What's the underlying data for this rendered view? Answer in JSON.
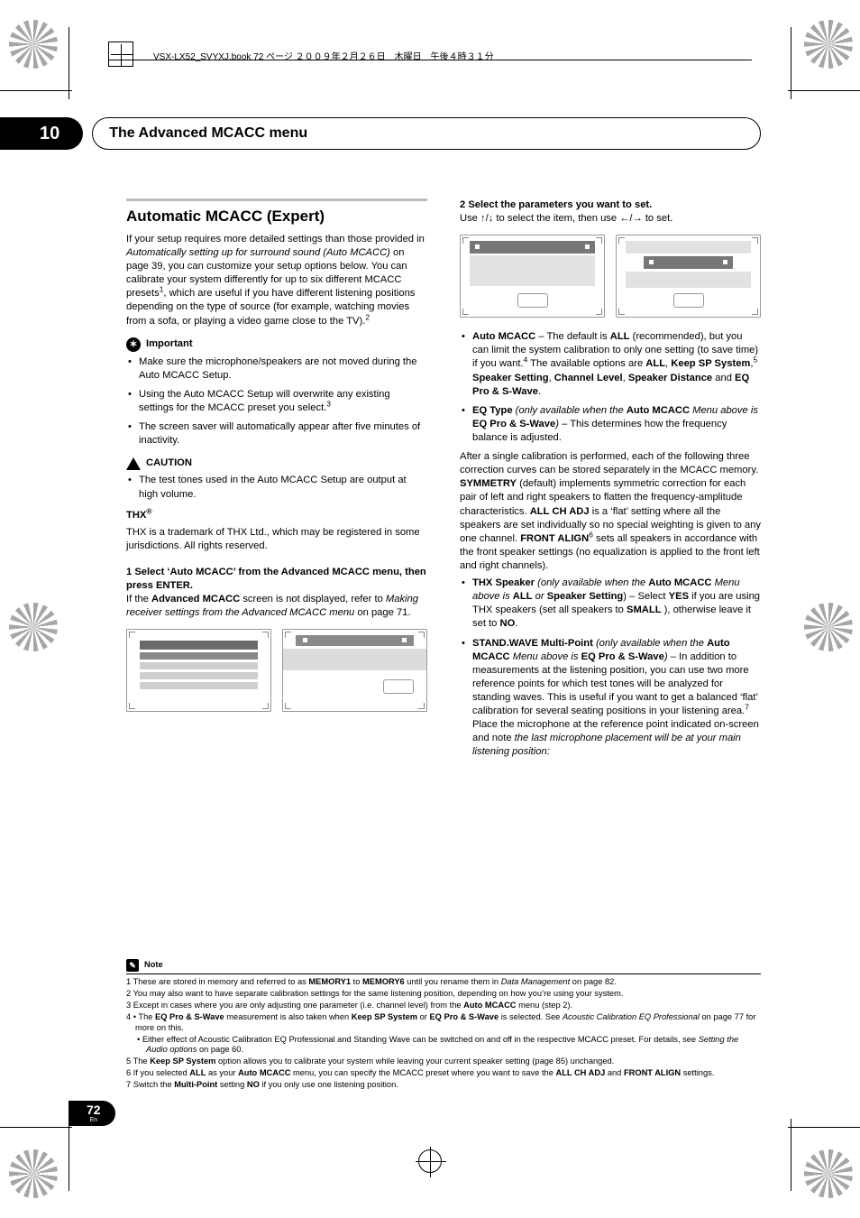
{
  "print_header": "VSX-LX52_SVYXJ.book  72 ページ  ２００９年２月２６日　木曜日　午後４時３１分",
  "chapter": {
    "number": "10",
    "title": "The Advanced MCACC menu"
  },
  "labels": {
    "important": "Important",
    "caution": "CAUTION",
    "note": "Note"
  },
  "page": {
    "number": "72",
    "lang": "En"
  },
  "sections": {
    "auto_mcacc": {
      "heading": "Automatic MCACC (Expert)",
      "intro": {
        "a": "If your setup requires more detailed settings than those provided in ",
        "b_ital": "Automatically setting up for surround sound (Auto MCACC)",
        "c": " on page 39, you can customize your setup options below. You can calibrate your system differently for up to six different MCACC presets",
        "sup1": "1",
        "d": ", which are useful if you have different listening positions depending on the type of source (for example, watching movies from a sofa, or playing a video game close to the TV).",
        "sup2": "2"
      },
      "important": [
        "Make sure the microphone/speakers are not moved during the Auto MCACC Setup.",
        "Using the Auto MCACC Setup will overwrite any existing settings for the MCACC preset you select.",
        "The screen saver will automatically appear after five minutes of inactivity."
      ],
      "important_sup": "3",
      "caution": [
        "The test tones used in the Auto MCACC Setup are output at high volume."
      ]
    },
    "thx": {
      "heading": "THX",
      "text": "THX is a trademark of THX Ltd., which may be registered in some jurisdictions. All rights reserved."
    }
  },
  "steps": [
    {
      "lead": "1    Select ‘Auto MCACC’ from the Advanced MCACC menu, then press ENTER.",
      "body_a": "If the ",
      "body_b_bold": "Advanced MCACC",
      "body_c": " screen is not displayed, refer to ",
      "body_d_ital": "Making receiver settings from the Advanced MCACC menu",
      "body_e": " on page 71."
    },
    {
      "lead": "2    Select the parameters you want to set.",
      "use_a": "Use ",
      "use_b": " to select the item, then use ",
      "use_c": " to set."
    }
  ],
  "params": {
    "auto_mcacc": {
      "name": "Auto MCACC",
      "a": " – The default is ",
      "b_bold": "ALL",
      "c": " (recommended), but you can limit the system calibration to only one setting (to save time) if you want.",
      "sup": "4",
      "d": " The available options are ",
      "opts": [
        "ALL",
        "Keep SP System",
        "Speaker Setting",
        "Channel Level",
        "Speaker Distance",
        "EQ Pro & S-Wave"
      ],
      "sup5": "5",
      "and": " and "
    },
    "eq_type": {
      "name": "EQ Type",
      "a_ital": " (only available when the ",
      "b_bold": "Auto MCACC",
      "c_ital": " Menu above is ",
      "d_bold": "EQ Pro & S-Wave",
      "e": " – This determines how the frequency balance is adjusted.",
      "para_a": "After a single calibration is performed, each of the following three correction curves can be stored separately in the MCACC memory. ",
      "para_b_bold": "SYMMETRY",
      "para_c": " (default) implements symmetric correction for each pair of left and right speakers to flatten the frequency-amplitude characteristics. ",
      "para_d_bold": "ALL CH ADJ",
      "para_e": " is a ‘flat’ setting where all the speakers are set individually so no special weighting is given to any one channel. ",
      "para_f_bold": "FRONT ALIGN",
      "sup6": "6",
      "para_g": " sets all speakers in accordance with the front speaker settings (no equalization is applied to the front left and right channels)."
    },
    "thx_speaker": {
      "name": "THX Speaker",
      "a_ital": " (only available when the ",
      "b_bold": "Auto MCACC",
      "c_ital": " Menu above is ",
      "d_bold": "ALL",
      "e_ital": " or ",
      "f_bold": "Speaker Setting",
      "g": " – Select ",
      "h_bold": "YES",
      "i": " if you are using THX speakers (set all speakers to ",
      "j_bold": "SMALL",
      "k": "), otherwise leave it set to ",
      "l_bold": "NO"
    },
    "stand_wave": {
      "name": "STAND.WAVE Multi-Point",
      "a_ital": " (only available when the ",
      "b_bold": "Auto MCACC",
      "c_ital": " Menu above is ",
      "d_bold": "EQ Pro & S-Wave",
      "e": " – In addition to measurements at the listening position, you can use two more reference points for which test tones will be analyzed for standing waves. This is useful if you want to get a balanced ‘flat’ calibration for several seating positions in your listening area.",
      "sup7": "7",
      "f": " Place the microphone at the reference point indicated on-screen and note ",
      "g_ital": "the last microphone placement will be at your main listening position:"
    }
  },
  "footnotes": {
    "0": {
      "a": "1 These are stored in memory and referred to as",
      "b": "MEMORY1",
      "c": "to",
      "d": "MEMORY6",
      "e": "until you rename them in",
      "f": "Data Management",
      "g": "on page 82."
    },
    "1": "2 You may also want to have separate calibration settings for the same listening position, depending on how you’re using your system.",
    "2": {
      "a": "3 Except in cases where you are only adjusting one parameter (i.e. channel level) from the",
      "b": "Auto MCACC",
      "c": "menu (step 2)."
    },
    "3": {
      "a": "4 • The",
      "b": "EQ Pro & S-Wave",
      "c": "measurement is also taken when",
      "d": "Keep SP System",
      "e": "or",
      "f": "EQ Pro & S-Wave",
      "g": "is selected. See",
      "h": "Acoustic Calibration EQ Professional",
      "i": "on page 77 for more on this."
    },
    "3sub": {
      "a": "• Either effect of Acoustic Calibration EQ Professional and Standing Wave can be switched on and off in the respective MCACC preset. For details, see",
      "b": "Setting the Audio options",
      "c": "on page 60."
    },
    "4": {
      "a": "5 The",
      "b": "Keep SP System",
      "c": "option allows you to calibrate your system while leaving your current speaker setting (page 85) unchanged."
    },
    "5": {
      "a": "6 If you selected",
      "b": "ALL",
      "c": "as your",
      "d": "Auto MCACC",
      "e": "menu, you can specify the MCACC preset where you want to save the",
      "f": "ALL CH ADJ",
      "g": "and",
      "h": "FRONT ALIGN",
      "i": "settings."
    },
    "6": {
      "a": "7 Switch the",
      "b": "Multi-Point",
      "c": "setting",
      "d": "NO",
      "e": "if you only use one listening position."
    }
  }
}
